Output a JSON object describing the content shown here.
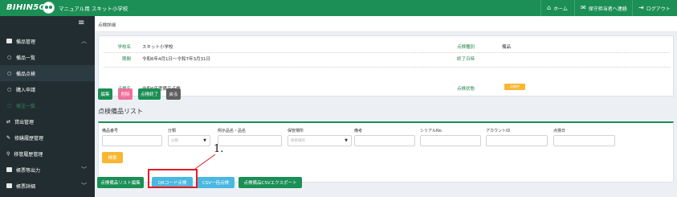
{
  "header": {
    "logo": "BIHIN5Go",
    "school_title": "マニュアル用 スキット小学校",
    "links": [
      {
        "icon": "⌂",
        "label": "ホーム"
      },
      {
        "icon": "✉",
        "label": "保守担当者へ連絡"
      },
      {
        "icon": "⇥",
        "label": "ログアウト"
      }
    ]
  },
  "sidebar": {
    "menu_icon": "≡",
    "items": [
      {
        "label": "備品管理"
      },
      {
        "label": "備品一覧"
      },
      {
        "label": "備品点検"
      },
      {
        "label": "購入申請"
      },
      {
        "label": "発注一覧"
      },
      {
        "label": "貸出管理"
      },
      {
        "label": "修繕履歴管理"
      },
      {
        "label": "移管履歴管理"
      },
      {
        "label": "帳票等出力"
      },
      {
        "label": "帳票詳細"
      }
    ]
  },
  "breadcrumb": "点検詳細",
  "detail": {
    "school_label": "学校名",
    "school_value": "スキット小学校",
    "type_label": "点検種別",
    "type_value": "備品",
    "period_label": "期間",
    "period_value": "令和6年4月1日～令和7年3月31日",
    "end_label": "終了日時",
    "end_value": "",
    "name_label": "点検名",
    "name_value": "令和6年度備品点検",
    "status_label": "点検状態",
    "status_value": "点検中"
  },
  "actions": {
    "edit": "編集",
    "delete": "削除",
    "finish": "点検終了",
    "back": "戻る"
  },
  "list_title": "点検備品リスト",
  "search": {
    "fields": [
      {
        "label": "備品番号",
        "placeholder": ""
      },
      {
        "label": "分類",
        "placeholder": "分類"
      },
      {
        "label": "例示品名・品名",
        "placeholder": ""
      },
      {
        "label": "保管場所",
        "placeholder": "保管場所"
      },
      {
        "label": "備考",
        "placeholder": ""
      },
      {
        "label": "シリアルNo",
        "placeholder": ""
      },
      {
        "label": "アカウントID",
        "placeholder": ""
      },
      {
        "label": "点検日",
        "placeholder": ""
      }
    ],
    "search_button": "検索"
  },
  "bottom_buttons": {
    "edit_list": "点検備品リスト編集",
    "qr_check": "QRコード点検",
    "csv_check": "CSV一括点検",
    "csv_export": "点検備品CSVエクスポート"
  },
  "annotation": {
    "label": "1."
  },
  "colors": {
    "brand_green": "#1b8f55",
    "sidebar_bg": "#222d32",
    "delete_pink": "#f0709c",
    "qr_blue": "#4ab8e0",
    "status_orange": "#f6b733",
    "annotation_red": "#e51c23"
  }
}
